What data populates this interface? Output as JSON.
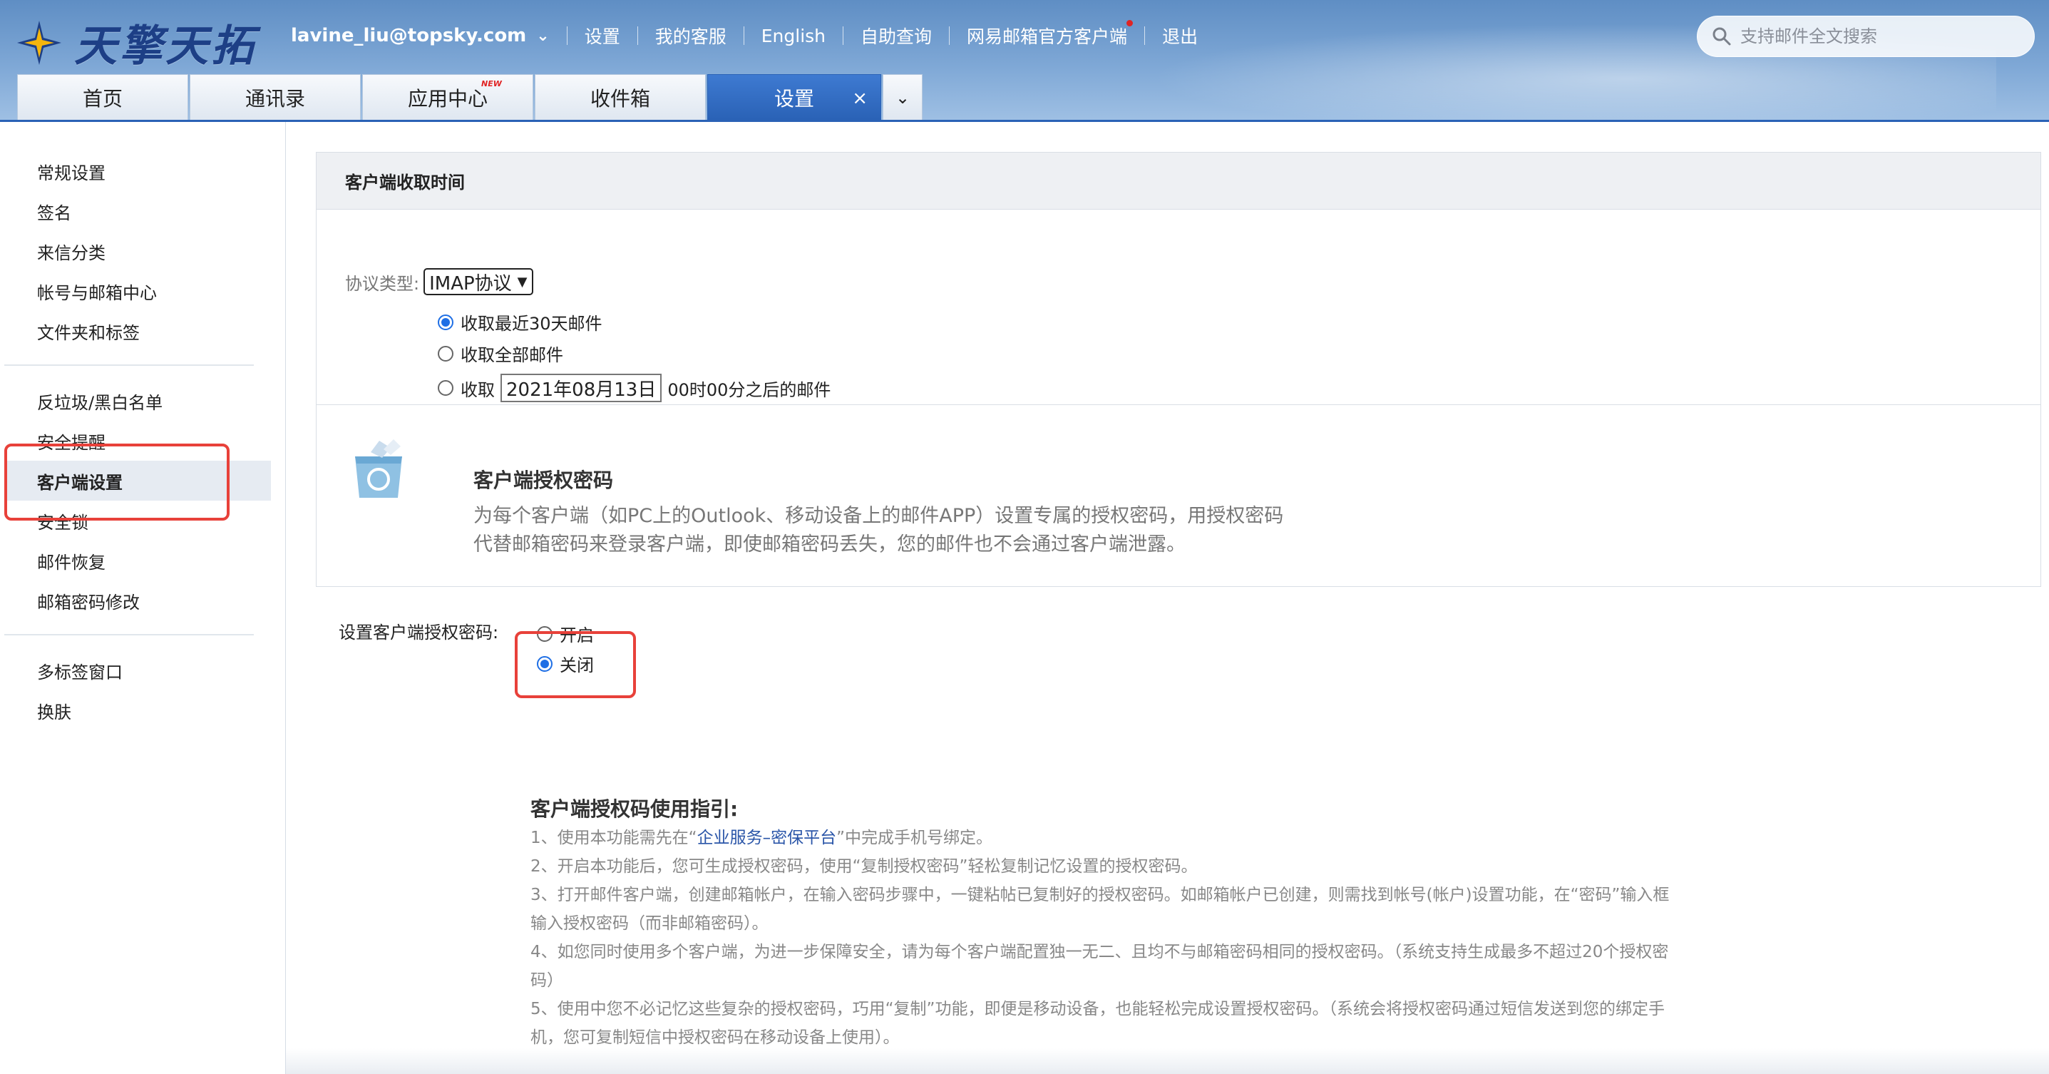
{
  "brand": {
    "logo_text": "天擎天拓"
  },
  "topnav": {
    "account": "lavine_liu@topsky.com",
    "links": [
      "设置",
      "我的客服",
      "English",
      "自助查询",
      "网易邮箱官方客户端",
      "退出"
    ]
  },
  "search": {
    "placeholder": "支持邮件全文搜索"
  },
  "tabs": {
    "items": [
      "首页",
      "通讯录",
      "应用中心",
      "收件箱",
      "设置"
    ],
    "new_badge": "NEW",
    "close": "×"
  },
  "sidebar": {
    "group1": [
      "常规设置",
      "签名",
      "来信分类",
      "帐号与邮箱中心",
      "文件夹和标签"
    ],
    "group2": [
      "反垃圾/黑白名单",
      "安全提醒",
      "客户端设置",
      "安全锁",
      "邮件恢复",
      "邮箱密码修改"
    ],
    "group3": [
      "多标签窗口",
      "换肤"
    ]
  },
  "receive_panel": {
    "title": "客户端收取时间",
    "protocol_label": "协议类型:",
    "protocol_value": "IMAP协议",
    "options": [
      "收取最近30天邮件",
      "收取全部邮件"
    ],
    "option3_prefix": "收取",
    "option3_date": "2021年08月13日",
    "option3_suffix": "00时00分之后的邮件",
    "selected": 0
  },
  "auth_panel": {
    "title": "客户端授权密码",
    "desc": "为每个客户端（如PC上的Outlook、移动设备上的邮件APP）设置专属的授权密码，用授权密码代替邮箱密码来登录客户端，即使邮箱密码丢失，您的邮件也不会通过客户端泄露。",
    "setting_label": "设置客户端授权密码:",
    "on_label": "开启",
    "off_label": "关闭",
    "selected": "off"
  },
  "guide": {
    "title": "客户端授权码使用指引:",
    "line1_pre": "1、使用本功能需先在“",
    "line1_link": "企业服务–密保平台",
    "line1_post": "”中完成手机号绑定。",
    "line2": "2、开启本功能后，您可生成授权密码，使用“复制授权密码”轻松复制记忆设置的授权密码。",
    "line3": "3、打开邮件客户端，创建邮箱帐户，在输入密码步骤中，一键粘帖已复制好的授权密码。如邮箱帐户已创建，则需找到帐号(帐户)设置功能，在“密码”输入框输入授权密码（而非邮箱密码）。",
    "line4": "4、如您同时使用多个客户端，为进一步保障安全，请为每个客户端配置独一无二、且均不与邮箱密码相同的授权密码。（系统支持生成最多不超过20个授权密码）",
    "line5": "5、使用中您不必记忆这些复杂的授权密码，巧用“复制”功能，即便是移动设备，也能轻松完成设置授权密码。（系统会将授权密码通过短信发送到您的绑定手机，您可复制短信中授权密码在移动设备上使用）。"
  },
  "colors": {
    "accent": "#2a62b6",
    "highlight": "#e8413a",
    "radio": "#1f6fe5"
  }
}
